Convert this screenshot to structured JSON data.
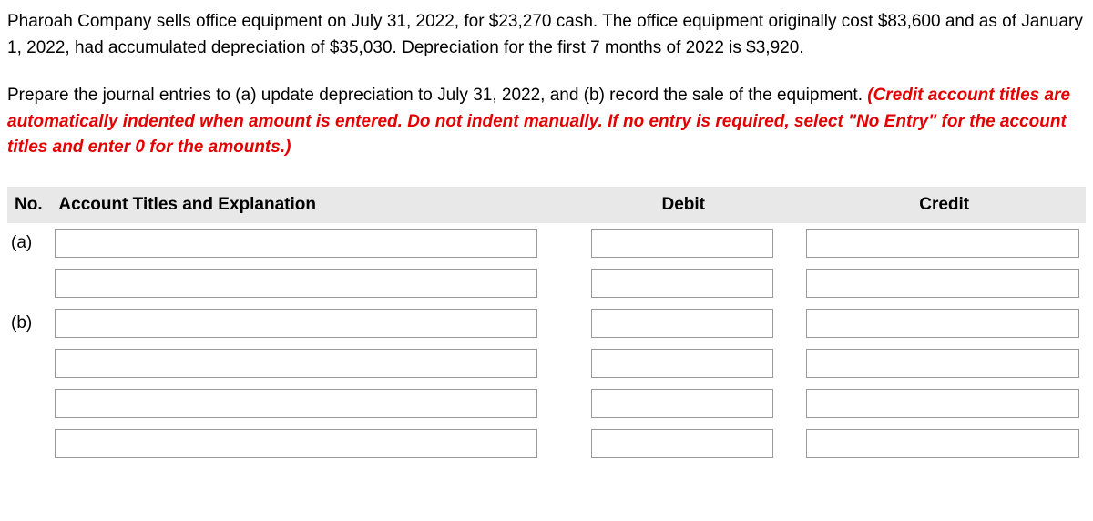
{
  "problem": {
    "paragraph1": "Pharoah Company sells office equipment on July 31, 2022, for $23,270 cash. The office equipment originally cost $83,600 and as of January 1, 2022, had accumulated depreciation of $35,030. Depreciation for the first 7 months of 2022 is $3,920.",
    "paragraph2_prefix": "Prepare the journal entries to (a) update depreciation to July 31, 2022, and (b) record the sale of the equipment. ",
    "paragraph2_hint": "(Credit account titles are automatically indented when amount is entered. Do not indent manually. If no entry is required, select \"No Entry\" for the account titles and enter 0 for the amounts.)"
  },
  "table": {
    "headers": {
      "no": "No.",
      "account": "Account Titles and Explanation",
      "debit": "Debit",
      "credit": "Credit"
    },
    "rows": [
      {
        "no": "(a)",
        "account": "",
        "debit": "",
        "credit": ""
      },
      {
        "no": "",
        "account": "",
        "debit": "",
        "credit": ""
      },
      {
        "no": "(b)",
        "account": "",
        "debit": "",
        "credit": ""
      },
      {
        "no": "",
        "account": "",
        "debit": "",
        "credit": ""
      },
      {
        "no": "",
        "account": "",
        "debit": "",
        "credit": ""
      },
      {
        "no": "",
        "account": "",
        "debit": "",
        "credit": ""
      }
    ]
  }
}
